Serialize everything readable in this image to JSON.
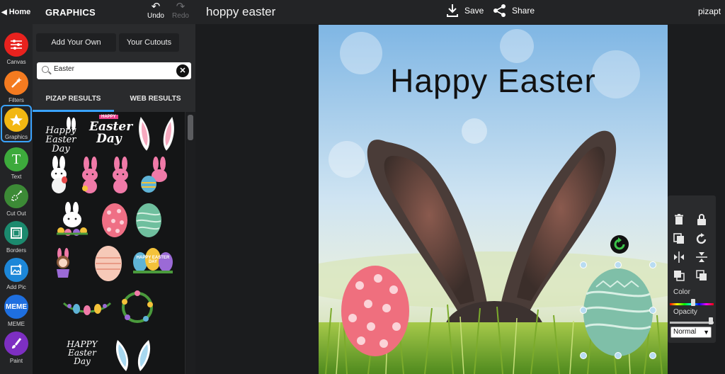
{
  "top_bar": {
    "home_label": "Home",
    "panel_title": "GRAPHICS",
    "undo_label": "Undo",
    "redo_label": "Redo",
    "project_title": "hoppy easter",
    "save_label": "Save",
    "share_label": "Share",
    "brand_text": "pizapt"
  },
  "rail": {
    "items": [
      {
        "label": "Canvas",
        "color": "#e8221e",
        "icon": "sliders-icon"
      },
      {
        "label": "Filters",
        "color": "#f47b20",
        "icon": "magic-wand-icon"
      },
      {
        "label": "Graphics",
        "color": "#f2b712",
        "icon": "stars-icon"
      },
      {
        "label": "Text",
        "color": "#3daa3c",
        "icon": "text-t-icon",
        "glyph": "T"
      },
      {
        "label": "Cut Out",
        "color": "#3c8a36",
        "icon": "cut-out-icon"
      },
      {
        "label": "Borders",
        "color": "#1b8a6e",
        "icon": "border-frame-icon"
      },
      {
        "label": "Add Pic",
        "color": "#1d87d8",
        "icon": "add-picture-icon"
      },
      {
        "label": "MEME",
        "color": "#1e6fe0",
        "icon": "meme-icon",
        "glyph": "MEME"
      },
      {
        "label": "Paint",
        "color": "#7d2fc2",
        "icon": "paintbrush-icon"
      }
    ]
  },
  "panel": {
    "add_your_own": "Add Your Own",
    "your_cutouts": "Your Cutouts",
    "search_value": "Easter",
    "tab_pizap": "PIZAP RESULTS",
    "tab_web": "WEB RESULTS",
    "sticker_texts": {
      "happy_easter_day_script": "Happy Easter Day",
      "happy_badge": "HAPPY",
      "easter_day_bold": "Easter Day",
      "happy_easter_day_eggs": "HAPPY EASTER DAY",
      "happy_easter_day_script2": "HAPPY Easter Day"
    }
  },
  "canvas": {
    "heading": "Happy Easter"
  },
  "tools": {
    "color_label": "Color",
    "opacity_label": "Opacity",
    "blend_mode": "Normal"
  },
  "colors": {
    "accent": "#3aa3ff",
    "rotate_handle": "#3cc34a"
  }
}
